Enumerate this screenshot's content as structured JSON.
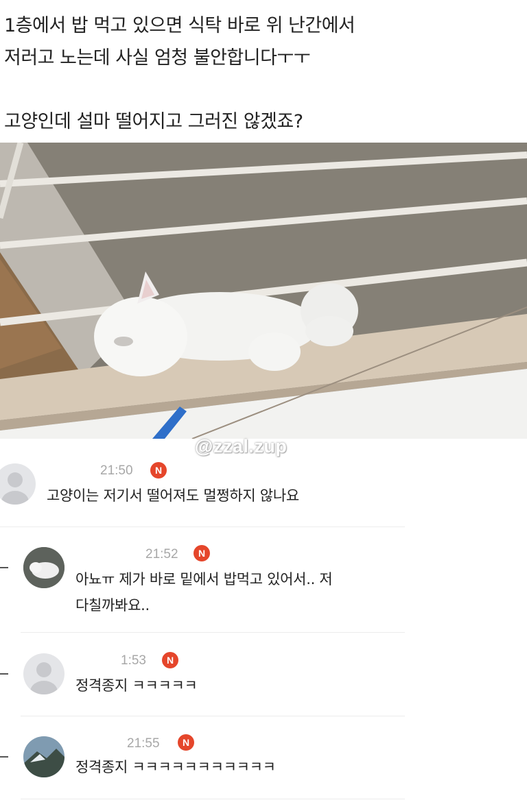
{
  "post": {
    "line1": "1층에서 밥 먹고 있으면 식탁 바로 위 난간에서",
    "line2": "저러고 노는데 사실 엄청 불안합니다ㅜㅜ",
    "line3": "고양인데 설마 떨어지고 그러진 않겠죠?"
  },
  "watermark": "@zzal.zup",
  "comments": [
    {
      "time": "21:50",
      "badge": "N",
      "text": "고양이는 저기서 떨어져도 멀쩡하지 않나요"
    },
    {
      "time": "21:52",
      "badge": "N",
      "line1": "아뇨ㅠ 제가 바로 밑에서 밥먹고 있어서.. 저",
      "line2": "다칠까봐요.."
    },
    {
      "time": "1:53",
      "badge": "N",
      "text": "정격종지 ㅋㅋㅋㅋㅋ"
    },
    {
      "time": "21:55",
      "badge": "N",
      "text": "정격종지 ㅋㅋㅋㅋㅋㅋㅋㅋㅋㅋㅋ"
    }
  ]
}
